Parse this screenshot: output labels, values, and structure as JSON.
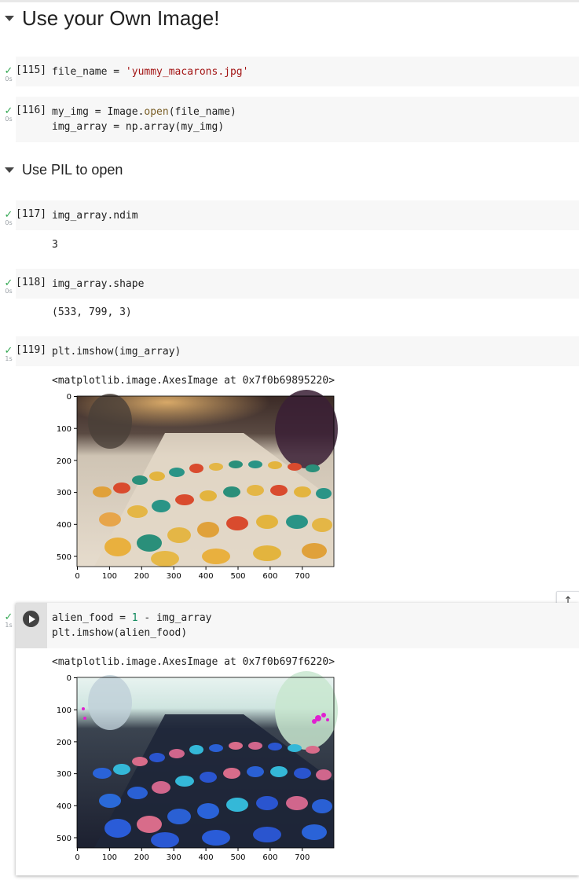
{
  "headings": {
    "main": "Use your Own Image!",
    "sub": "Use PIL to open"
  },
  "cells": [
    {
      "count": "[115]",
      "time": "0s",
      "lines": [
        "file_name = 'yummy_macarons.jpg'"
      ]
    },
    {
      "count": "[116]",
      "time": "0s",
      "lines": [
        "my_img = Image.open(file_name)",
        "img_array = np.array(my_img)"
      ]
    },
    {
      "count": "[117]",
      "time": "0s",
      "lines": [
        "img_array.ndim"
      ],
      "output": "3"
    },
    {
      "count": "[118]",
      "time": "0s",
      "lines": [
        "img_array.shape"
      ],
      "output": "(533, 799, 3)"
    },
    {
      "count": "[119]",
      "time": "1s",
      "lines": [
        "plt.imshow(img_array)"
      ],
      "output": "<matplotlib.image.AxesImage at 0x7f0b69895220>"
    },
    {
      "count": "",
      "time": "1s",
      "lines": [
        "alien_food = 1 - img_array",
        "plt.imshow(alien_food)"
      ],
      "output": "<matplotlib.image.AxesImage at 0x7f0b697f6220>"
    }
  ],
  "status_icon": "check-icon",
  "colors": {
    "check": "#34a853",
    "string": "#a31515",
    "function": "#795e26",
    "number": "#098658"
  },
  "plot_axes": {
    "x_ticks": [
      "0",
      "100",
      "200",
      "300",
      "400",
      "500",
      "600",
      "700"
    ],
    "y_ticks": [
      "0",
      "100",
      "200",
      "300",
      "400",
      "500"
    ]
  }
}
